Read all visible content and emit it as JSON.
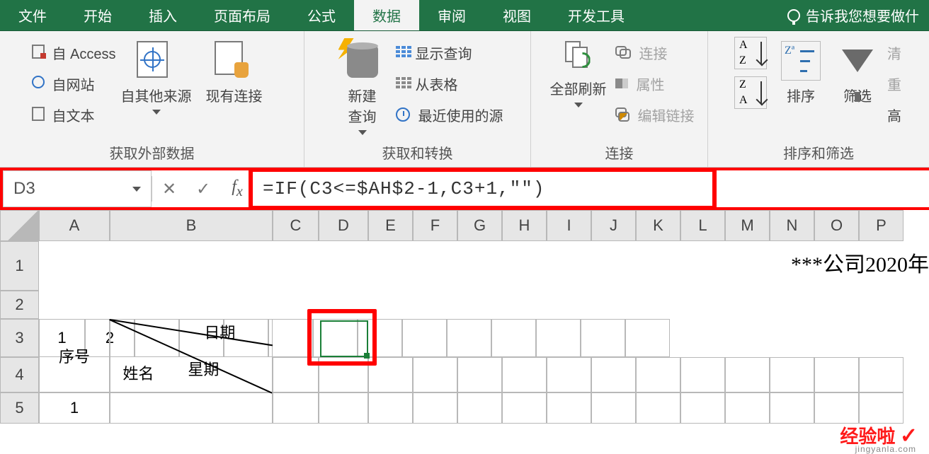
{
  "tabs": {
    "items": [
      "文件",
      "开始",
      "插入",
      "页面布局",
      "公式",
      "数据",
      "审阅",
      "视图",
      "开发工具"
    ],
    "active": 5,
    "tell_me": "告诉我您想要做什"
  },
  "ribbon": {
    "group1": {
      "label": "获取外部数据",
      "access": "自 Access",
      "web": "自网站",
      "text": "自文本",
      "other": "自其他来源",
      "existing": "现有连接"
    },
    "group2": {
      "label": "获取和转换",
      "newquery": "新建\n查询",
      "showq": "显示查询",
      "fromtable": "从表格",
      "recent": "最近使用的源"
    },
    "group3": {
      "label": "连接",
      "refresh": "全部刷新",
      "conn": "连接",
      "prop": "属性",
      "editlink": "编辑链接"
    },
    "group4": {
      "label": "排序和筛选",
      "sort": "排序",
      "filter": "筛选",
      "clear": "清",
      "reapply": "重",
      "advanced": "高"
    }
  },
  "fx": {
    "namebox": "D3",
    "formula": "=IF(C3<=$AH$2-1,C3+1,\"\")"
  },
  "cols": {
    "labels": [
      "A",
      "B",
      "C",
      "D",
      "E",
      "F",
      "G",
      "H",
      "I",
      "J",
      "K",
      "L",
      "M",
      "N",
      "O",
      "P"
    ],
    "widths": [
      100,
      230,
      65,
      70,
      63,
      63,
      63,
      63,
      63,
      63,
      63,
      63,
      63,
      63,
      63,
      63
    ]
  },
  "rows": {
    "labels": [
      "1",
      "2",
      "3",
      "4",
      "5"
    ],
    "heights": [
      70,
      40,
      54,
      50,
      44
    ]
  },
  "headers": {
    "xuhao": "序号",
    "xingming": "姓名",
    "riqi": "日期",
    "xingqi": "星期"
  },
  "title": "***公司2020年",
  "data": {
    "C3": "1",
    "D3": "2",
    "A5": "1"
  },
  "watermark": {
    "main": "经验啦",
    "check": "✓",
    "sub": "jingyanla.com"
  }
}
